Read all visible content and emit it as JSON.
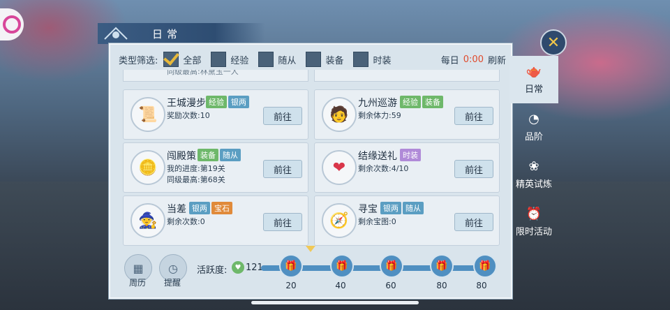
{
  "title": "日常",
  "filter": {
    "label": "类型筛选:",
    "options": [
      {
        "label": "全部",
        "checked": true
      },
      {
        "label": "经验",
        "checked": false
      },
      {
        "label": "随从",
        "checked": false
      },
      {
        "label": "装备",
        "checked": false
      },
      {
        "label": "时装",
        "checked": false
      }
    ]
  },
  "refresh": {
    "prefix": "每日",
    "time": "0:00",
    "suffix": "刷新"
  },
  "partial_text": "同级最高:林黛玉一人",
  "tasks": [
    {
      "name": "王城漫步",
      "tags": [
        {
          "text": "经验",
          "color": "green"
        },
        {
          "text": "银两",
          "color": "blue"
        }
      ],
      "line1": "奖励次数:10",
      "line2": "",
      "icon": "scroll-icon",
      "button": "前往"
    },
    {
      "name": "九州巡游",
      "tags": [
        {
          "text": "经验",
          "color": "green"
        },
        {
          "text": "装备",
          "color": "green"
        }
      ],
      "line1": "剩余体力:59",
      "line2": "",
      "icon": "character-icon",
      "button": "前往"
    },
    {
      "name": "闯殿策",
      "tags": [
        {
          "text": "装备",
          "color": "green"
        },
        {
          "text": "随从",
          "color": "blue"
        }
      ],
      "line1": "我的进度:第19关",
      "line2": "同级最高:第68关",
      "icon": "coin-icon",
      "button": "前往"
    },
    {
      "name": "结缘送礼",
      "tags": [
        {
          "text": "时装",
          "color": "purple"
        }
      ],
      "line1": "剩余次数:4/10",
      "line2": "",
      "icon": "heart-icon",
      "button": "前往"
    },
    {
      "name": "当差",
      "tags": [
        {
          "text": "银两",
          "color": "blue"
        },
        {
          "text": "宝石",
          "color": "orange"
        }
      ],
      "line1": "剩余次数:0",
      "line2": "",
      "icon": "character-icon",
      "button": "前往"
    },
    {
      "name": "寻宝",
      "tags": [
        {
          "text": "银两",
          "color": "blue"
        },
        {
          "text": "随从",
          "color": "blue"
        }
      ],
      "line1": "剩余宝图:0",
      "line2": "",
      "icon": "compass-icon",
      "button": "前往"
    }
  ],
  "bottom": {
    "calendar_label": "周历",
    "reminder_label": "提醒",
    "activity_label": "活跃度:",
    "activity_value": "121",
    "milestones": [
      "20",
      "40",
      "60",
      "80",
      "80"
    ]
  },
  "sidebar": [
    {
      "label": "日常",
      "icon": "teapot-icon",
      "active": true
    },
    {
      "label": "品阶",
      "icon": "fan-icon",
      "active": false
    },
    {
      "label": "精英试炼",
      "icon": "flower-icon",
      "active": false
    },
    {
      "label": "限时活动",
      "icon": "alarm-icon",
      "active": false
    }
  ],
  "close_symbol": "✕"
}
